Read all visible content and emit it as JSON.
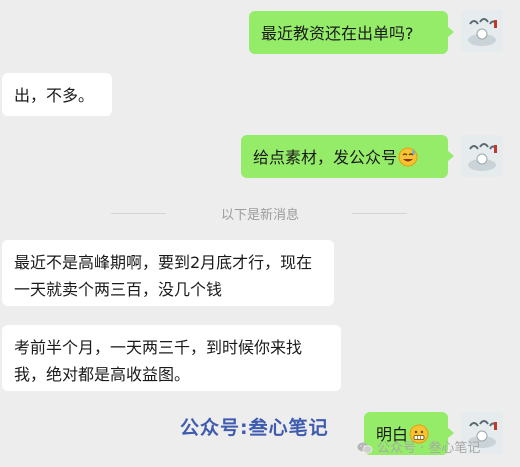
{
  "chat": {
    "messages": [
      {
        "from": "me",
        "text": "最近教资还在出单吗?"
      },
      {
        "from": "other",
        "text": "出，不多。"
      },
      {
        "from": "me",
        "text": "给点素材，发公众号",
        "emoji": "sweat-smile-emoji"
      },
      {
        "from": "other",
        "text": "最近不是高峰期啊，要到2月底才行，现在一天就卖个两三百，没几个钱"
      },
      {
        "from": "other",
        "text": "考前半个月，一天两三千，到时候你来找我，绝对都是高收益图。"
      },
      {
        "from": "me",
        "text": "明白",
        "emoji": "grimace-emoji"
      }
    ],
    "divider": "以下是新消息"
  },
  "watermarks": {
    "overlay": "公众号:叁心笔记",
    "wechat": "公众号 · 叁心笔记"
  },
  "colors": {
    "background": "#ededed",
    "incoming_bubble": "#ffffff",
    "outgoing_bubble": "#95ec69",
    "overlay_watermark": "#3f5bb0"
  }
}
